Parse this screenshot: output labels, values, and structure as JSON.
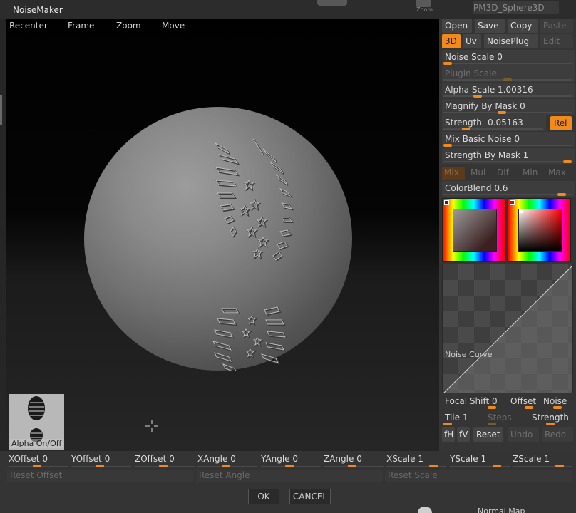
{
  "window": {
    "title": "NoiseMaker"
  },
  "background": {
    "zoom_label": "Zoom",
    "tool_label": "PM3D_Sphere3D",
    "bottom_item": "Normal Map"
  },
  "viewport": {
    "menu": [
      "Recenter",
      "Frame",
      "Zoom",
      "Move"
    ],
    "alpha_toggle": "Alpha On/Off"
  },
  "panel": {
    "file_buttons": [
      "Open",
      "Save",
      "Copy",
      "Paste"
    ],
    "mode_buttons": [
      "3D",
      "Uv",
      "NoisePlug",
      "Edit"
    ],
    "sliders": [
      {
        "label": "Noise Scale",
        "value": "0",
        "level": 0.0
      },
      {
        "label": "Plugin Scale",
        "value": "",
        "level": 0.5,
        "disabled": true
      },
      {
        "label": "Alpha Scale",
        "value": "1.00316",
        "level": 0.25
      },
      {
        "label": "Magnify By Mask",
        "value": "0",
        "level": 0.45
      },
      {
        "label": "Strength",
        "value": "-0.05163",
        "level": 0.2
      },
      {
        "label": "Mix Basic Noise",
        "value": "0",
        "level": 0.0
      },
      {
        "label": "Strength By Mask",
        "value": "1",
        "level": 1.0
      }
    ],
    "rel_label": "Rel",
    "mix_modes": [
      "Mix",
      "Mul",
      "Dif",
      "Min",
      "Max"
    ],
    "color_blend": {
      "label": "ColorBlend",
      "value": "0.6",
      "level": 0.95
    },
    "noise_curve_label": "Noise Curve",
    "focal_shift": {
      "label": "Focal Shift",
      "value": "0"
    },
    "offset_label": "Offset",
    "noise_label": "Noise",
    "tile": {
      "label": "Tile",
      "value": "1"
    },
    "steps_label": "Steps",
    "strength_label": "Strength",
    "edit_buttons": [
      "fH",
      "fV",
      "Reset",
      "Undo",
      "Redo"
    ]
  },
  "bottom": {
    "sliders": [
      {
        "label": "XOffset",
        "value": "0"
      },
      {
        "label": "YOffset",
        "value": "0"
      },
      {
        "label": "ZOffset",
        "value": "0"
      },
      {
        "label": "XAngle",
        "value": "0"
      },
      {
        "label": "YAngle",
        "value": "0"
      },
      {
        "label": "ZAngle",
        "value": "0"
      },
      {
        "label": "XScale",
        "value": "1"
      },
      {
        "label": "YScale",
        "value": "1"
      },
      {
        "label": "ZScale",
        "value": "1"
      }
    ],
    "reset_buttons": [
      "Reset Offset",
      "Reset Angle",
      "Reset Scale"
    ],
    "ok_label": "OK",
    "cancel_label": "CANCEL"
  },
  "colors": {
    "accent": "#f08a1a"
  }
}
